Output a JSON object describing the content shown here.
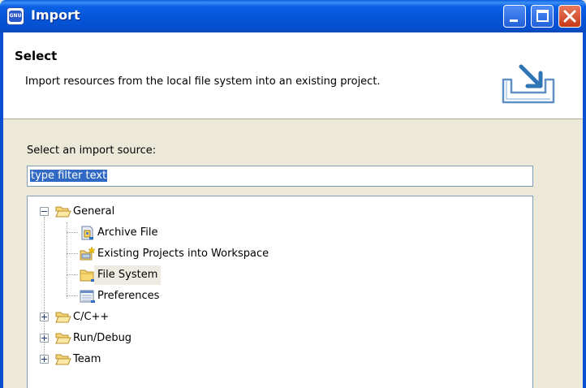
{
  "window": {
    "title": "Import",
    "app_icon_text": "GNU",
    "titlebar_color": "#0a5fe2",
    "buttons": [
      "minimize",
      "maximize",
      "close"
    ]
  },
  "header": {
    "title": "Select",
    "description": "Import resources from the local file system into an existing project.",
    "banner_icon": "import-wizard-icon"
  },
  "source": {
    "label": "Select an import source:",
    "filter_value": "type filter text"
  },
  "tree": {
    "items": [
      {
        "label": "General",
        "expanded": true,
        "icon": "folder-open-icon"
      },
      {
        "label": "Archive File",
        "icon": "archive-file-icon"
      },
      {
        "label": "Existing Projects into Workspace",
        "icon": "project-icon"
      },
      {
        "label": "File System",
        "icon": "folder-icon",
        "selected": true
      },
      {
        "label": "Preferences",
        "icon": "preferences-icon"
      },
      {
        "label": "C/C++",
        "expanded": false,
        "icon": "folder-open-icon"
      },
      {
        "label": "Run/Debug",
        "expanded": false,
        "icon": "folder-open-icon"
      },
      {
        "label": "Team",
        "expanded": false,
        "icon": "folder-open-icon"
      }
    ]
  },
  "colors": {
    "selection": "#316ac5",
    "dialog_bg": "#ece9d8",
    "hover_row": "#eeece2"
  }
}
